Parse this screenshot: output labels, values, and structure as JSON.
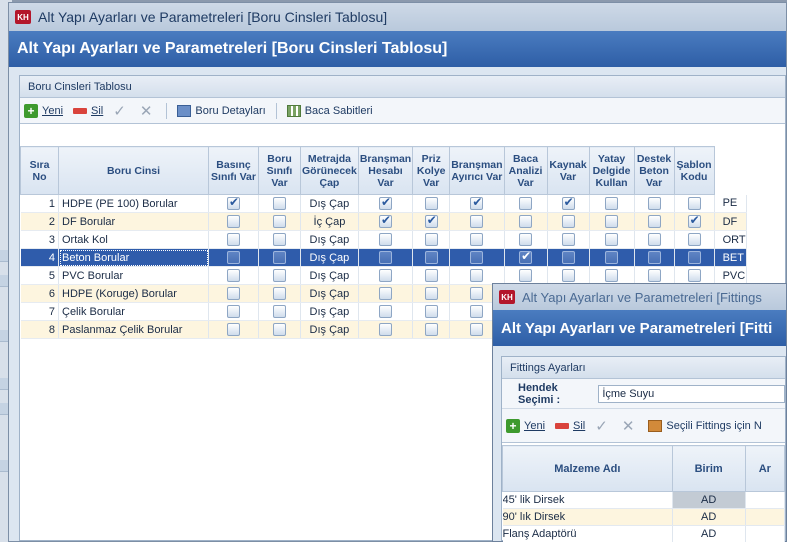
{
  "main_window": {
    "title": "Alt Yapı Ayarları ve Parametreleri [Boru Cinsleri Tablosu]",
    "header": "Alt Yapı Ayarları ve Parametreleri [Boru Cinsleri Tablosu]",
    "app_badge": "KH",
    "panel_title": "Boru Cinsleri Tablosu",
    "toolbar": {
      "new_label": "Yeni",
      "delete_label": "Sil",
      "pipe_details_label": "Boru Detayları",
      "baca_constants_label": "Baca Sabitleri"
    },
    "columns": [
      "Sıra No",
      "Boru Cinsi",
      "Basınç Sınıfı Var",
      "Boru Sınıfı Var",
      "Metrajda Görünecek Çap",
      "Branşman Hesabı Var",
      "Priz Kolye Var",
      "Branşman Ayırıcı Var",
      "Baca Analizi Var",
      "Kaynak Var",
      "Yatay Delgide Kullan",
      "Destek Beton Var",
      "Şablon Kodu"
    ],
    "rows": [
      {
        "no": "1",
        "name": "HDPE (PE 100) Borular",
        "cap": "Dış Çap",
        "code": "PE",
        "checks": [
          true,
          false,
          true,
          false,
          true,
          false,
          true,
          false,
          false,
          false
        ]
      },
      {
        "no": "2",
        "name": "DF Borular",
        "cap": "İç Çap",
        "code": "DF",
        "checks": [
          false,
          false,
          true,
          true,
          false,
          false,
          false,
          false,
          false,
          true
        ]
      },
      {
        "no": "3",
        "name": "Ortak Kol",
        "cap": "Dış Çap",
        "code": "ORT",
        "checks": [
          false,
          false,
          false,
          false,
          false,
          false,
          false,
          false,
          false,
          false
        ]
      },
      {
        "no": "4",
        "name": "Beton Borular",
        "cap": "Dış Çap",
        "code": "BET",
        "checks": [
          false,
          false,
          false,
          false,
          false,
          true,
          false,
          false,
          false,
          false
        ]
      },
      {
        "no": "5",
        "name": "PVC Borular",
        "cap": "Dış Çap",
        "code": "PVC",
        "checks": [
          false,
          false,
          false,
          false,
          false,
          false,
          false,
          false,
          false,
          false
        ]
      },
      {
        "no": "6",
        "name": "HDPE (Koruge) Borular",
        "cap": "Dış Çap",
        "code": "",
        "checks": [
          false,
          false,
          false,
          false,
          false,
          false,
          false,
          false,
          false,
          false
        ]
      },
      {
        "no": "7",
        "name": "Çelik Borular",
        "cap": "Dış Çap",
        "code": "",
        "checks": [
          false,
          false,
          false,
          false,
          false,
          false,
          false,
          false,
          false,
          false
        ]
      },
      {
        "no": "8",
        "name": "Paslanmaz Çelik Borular",
        "cap": "Dış Çap",
        "code": "",
        "checks": [
          false,
          false,
          false,
          false,
          false,
          false,
          false,
          false,
          false,
          false
        ]
      }
    ],
    "selected_row": 4
  },
  "fittings_window": {
    "title": "Alt Yapı Ayarları ve Parametreleri [Fittings",
    "header": "Alt Yapı Ayarları ve Parametreleri [Fitti",
    "app_badge": "KH",
    "panel_title": "Fittings Ayarları",
    "hendek_label": "Hendek Seçimi :",
    "hendek_value": "İçme Suyu",
    "toolbar": {
      "new_label": "Yeni",
      "delete_label": "Sil",
      "selected_fittings_label": "Seçili Fittings için N"
    },
    "columns": [
      "Malzeme Adı",
      "Birim",
      "Ar"
    ],
    "rows": [
      {
        "name": "45' lik Dirsek",
        "unit": "AD"
      },
      {
        "name": "90' lık Dirsek",
        "unit": "AD"
      },
      {
        "name": "Flanş Adaptörü",
        "unit": "AD"
      }
    ]
  },
  "colors": {
    "header_blue": "#2e5ea6",
    "selected_row": "#2f5cab",
    "alt_row": "#fdf5df",
    "badge_red": "#b3162b"
  }
}
